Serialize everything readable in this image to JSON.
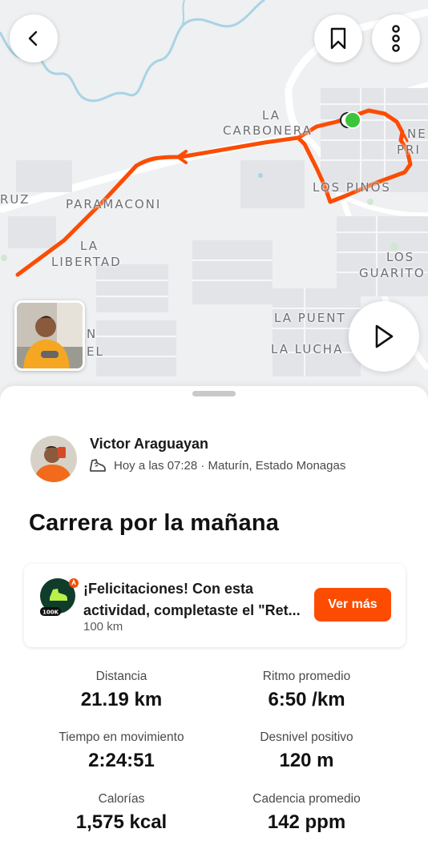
{
  "map": {
    "labels": [
      "LA",
      "CARBONERA",
      "NE",
      "PRI",
      "LOS PINOS",
      "RUZ",
      "PARAMACONI",
      "LA",
      "LIBERTAD",
      "LOS",
      "GUARITO",
      "LA PUENT",
      "LA LUCHA",
      "N",
      "EL"
    ],
    "route_color": "#fc4c02",
    "start_color": "#3cc43c"
  },
  "header": {
    "back_icon": "chevron-left-icon",
    "bookmark_icon": "bookmark-icon",
    "more_icon": "more-vertical-icon"
  },
  "player": {
    "play_icon": "play-icon"
  },
  "activity": {
    "athlete_name": "Victor Araguayan",
    "meta": "Hoy a las 07:28 · Maturín, Estado Monagas",
    "title": "Carrera por la mañana"
  },
  "achievement": {
    "text": "¡Felicitaciones! Con esta actividad, completaste el \"Ret...",
    "sub": "100 km",
    "badge_label": "100K",
    "button_label": "Ver más"
  },
  "stats": [
    {
      "label": "Distancia",
      "value": "21.19 km"
    },
    {
      "label": "Ritmo promedio",
      "value": "6:50 /km"
    },
    {
      "label": "Tiempo en movimiento",
      "value": "2:24:51"
    },
    {
      "label": "Desnivel positivo",
      "value": "120 m"
    },
    {
      "label": "Calorías",
      "value": "1,575 kcal"
    },
    {
      "label": "Cadencia promedio",
      "value": "142 ppm"
    }
  ],
  "colors": {
    "accent": "#fc4c02"
  }
}
